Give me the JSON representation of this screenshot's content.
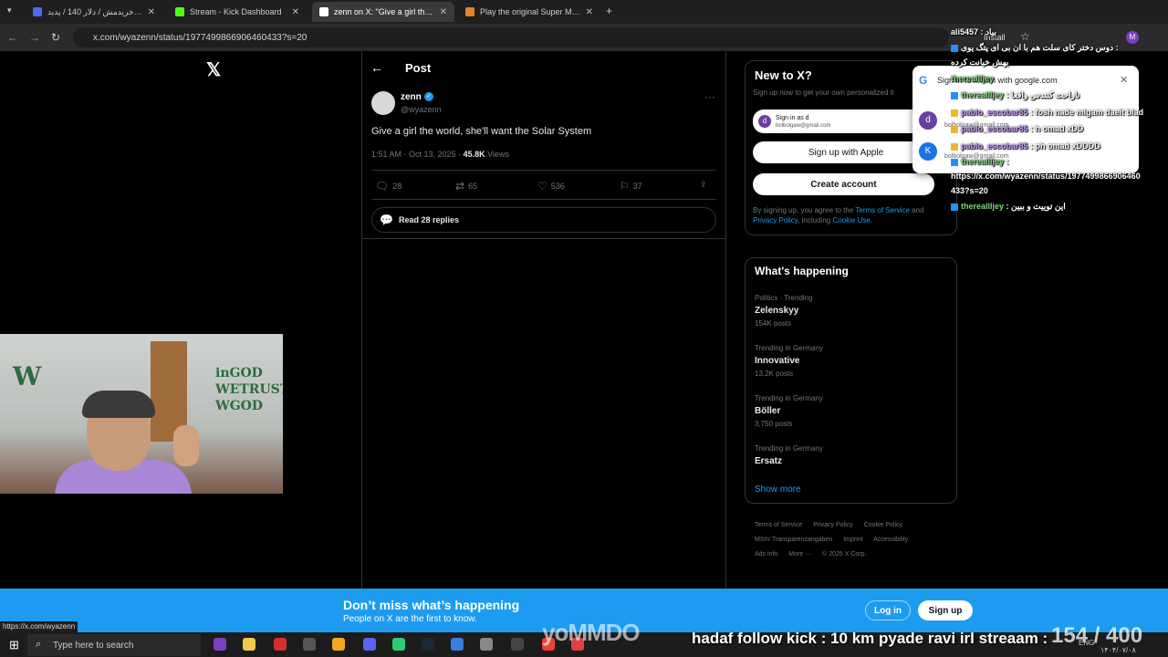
{
  "browser": {
    "tabs": [
      {
        "label": "بلاخره خریدمش / دلار 140 / پدید",
        "active": false,
        "color": "#4a6cf7"
      },
      {
        "label": "Stream - Kick Dashboard",
        "active": false,
        "color": "#53fc18"
      },
      {
        "label": "zenn on X: \"Give a girl the worl",
        "active": true,
        "color": "#ffffff"
      },
      {
        "label": "Play the original Super Mario B",
        "active": false,
        "color": "#e8812a"
      }
    ],
    "url": "x.com/wyazenn/status/1977499866906460433?s=20",
    "install": "Install",
    "profile_initial": "M"
  },
  "post": {
    "header": "Post",
    "author_name": "zenn",
    "author_handle": "@wyazenn",
    "text": "Give a girl the world, she'll want the Solar System",
    "time": "1:51 AM · Oct 13, 2025 · ",
    "views_count": "45.8K",
    "views_label": " Views",
    "replies": "28",
    "reposts": "65",
    "likes": "536",
    "bookmarks": "37",
    "read_replies": "Read 28 replies"
  },
  "signup": {
    "title": "New to X?",
    "subtitle": "Sign up now to get your own personalized ti",
    "signin_as": "Sign in as d",
    "signin_email": "bolbolgaw@gmail.com",
    "apple": "Sign up with Apple",
    "create": "Create account",
    "terms_prefix": "By signing up, you agree to the ",
    "terms_tos": "Terms of Service",
    "terms_and": " and ",
    "terms_privacy": "Privacy Policy",
    "terms_including": ", including ",
    "terms_cookie": "Cookie Use."
  },
  "trending": {
    "title": "What's happening",
    "items": [
      {
        "category": "Politics · Trending",
        "name": "Zelenskyy",
        "count": "154K posts"
      },
      {
        "category": "Trending in Germany",
        "name": "Innovative",
        "count": "13.2K posts"
      },
      {
        "category": "Trending in Germany",
        "name": "Böller",
        "count": "3,750 posts"
      },
      {
        "category": "Trending in Germany",
        "name": "Ersatz",
        "count": ""
      }
    ],
    "show_more": "Show more"
  },
  "footer": {
    "links": [
      "Terms of Service",
      "Privacy Policy",
      "Cookie Policy",
      "MStV Transparenzangaben",
      "Imprint",
      "Accessibility",
      "Ads info",
      "More ···",
      "© 2025 X Corp."
    ]
  },
  "google_popup": {
    "title": "Sign in to x.com with google.com",
    "accounts": [
      {
        "initial": "d",
        "name": "d",
        "email": "bolbolgaw@gmail.com",
        "color": "#6b3fa0"
      },
      {
        "initial": "K",
        "name": "K",
        "email": "bolbolgaw@gmail.com",
        "color": "#1a73e8"
      }
    ]
  },
  "chat": [
    {
      "user": "ali5457",
      "msg": ": بیاد",
      "color": "#ffffff"
    },
    {
      "user": "",
      "msg": "دوس دختر کای سلت هم با ان بی ای پتگ یوی :",
      "color": "#ffffff"
    },
    {
      "user": "",
      "msg": "بهش خیانت کرده",
      "color": "#ffffff"
    },
    {
      "user": "thereallljey",
      "msg": "",
      "color": "#7dd87a"
    },
    {
      "user": "thereallljey",
      "msg": ": ناراحت کنندس واقعا",
      "color": "#7dd87a"
    },
    {
      "user": "pablo_escobar85",
      "msg": ": fosh nade migam daeit biad",
      "color": "#c89cff"
    },
    {
      "user": "pablo_escobar85",
      "msg": ": h omad xDD",
      "color": "#c89cff"
    },
    {
      "user": "pablo_escobar85",
      "msg": ": ph omad xDDDD",
      "color": "#c89cff"
    },
    {
      "user": "thereallljey",
      "msg": ":",
      "color": "#7dd87a"
    },
    {
      "user": "",
      "msg": "https://x.com/wyazenn/status/1977499866906460",
      "color": "#ffffff"
    },
    {
      "user": "",
      "msg": "433?s=20",
      "color": "#ffffff"
    },
    {
      "user": "thereallljey",
      "msg": ": این توییت و ببین",
      "color": "#7dd87a"
    }
  ],
  "banner": {
    "title": "Don’t miss what’s happening",
    "subtitle": "People on X are the first to know.",
    "login": "Log in",
    "signup": "Sign up"
  },
  "overlay": {
    "logo": "yoMMDO",
    "goal": "hadaf follow kick : 10 km pyade ravi irl streaam :",
    "counter": "154 / 400"
  },
  "status_url": "https://x.com/wyazenn",
  "taskbar": {
    "search_placeholder": "Type here to search",
    "lang": "ENG",
    "date": "۱۴۰۴/۰۷/۰۸"
  }
}
